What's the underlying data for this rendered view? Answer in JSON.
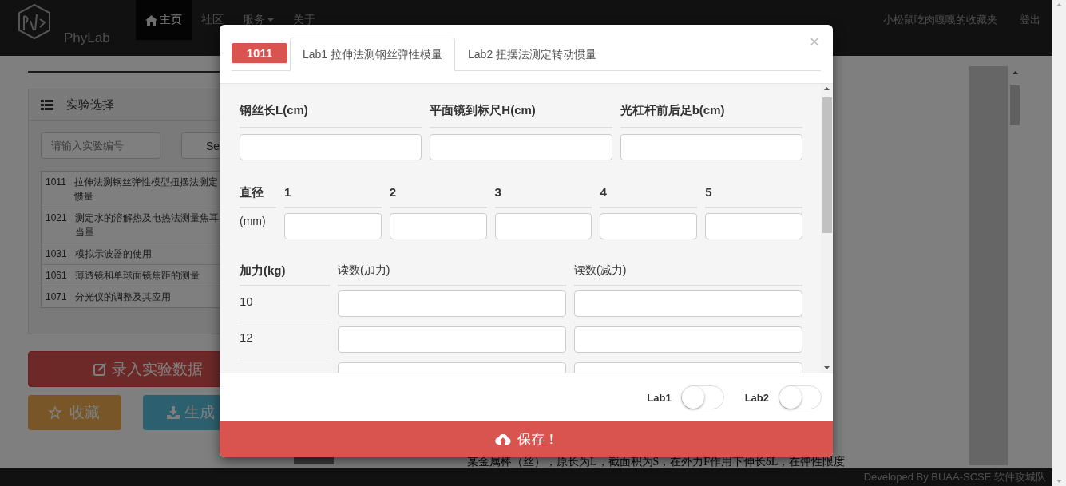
{
  "navbar": {
    "brand": "PhyLab",
    "items": [
      {
        "label": "主页",
        "selected": true
      },
      {
        "label": "社区",
        "selected": false
      },
      {
        "label": "服务",
        "selected": false,
        "dropdown": true
      },
      {
        "label": "关于",
        "selected": false
      }
    ],
    "user": "小松鼠吃肉嘎嘎的收藏夹",
    "logout": "登出"
  },
  "sidebar": {
    "title": "实验选择",
    "search_placeholder": "请输入实验编号",
    "search_button": "Se",
    "experiments": [
      {
        "code": "1011",
        "name": "拉伸法测钢丝弹性模型扭摆法测定",
        "name_continued": "惯量"
      },
      {
        "code": "1021",
        "name": "测定水的溶解热及电热法测量焦耳",
        "name_continued": "当量"
      },
      {
        "code": "1031",
        "name": "模拟示波器的使用"
      },
      {
        "code": "1061",
        "name": "薄透镜和单球面镜焦距的测量"
      },
      {
        "code": "1071",
        "name": "分光仪的调整及其应用"
      }
    ],
    "enter_button": "录入实验数据",
    "favorite_button": "收藏",
    "report_button": "生成"
  },
  "document_text": "某金属棒（丝），原长为L，截面积为S，在外力F作用下伸长δL，在弹性限度",
  "modal": {
    "badge": "1011",
    "tabs": [
      {
        "label": "Lab1 拉伸法测钢丝弹性模量",
        "selected": true
      },
      {
        "label": "Lab2 扭摆法测定转动惯量",
        "selected": false
      }
    ],
    "close": "×",
    "length_fields": [
      "钢丝长L(cm)",
      "平面镜到标尺H(cm)",
      "光杠杆前后足b(cm)"
    ],
    "diameter": {
      "label": "直径",
      "unit": "(mm)",
      "columns": [
        "1",
        "2",
        "3",
        "4",
        "5"
      ]
    },
    "force_table": {
      "columns": [
        "加力(kg)",
        "读数(加力)",
        "读数(减力)"
      ],
      "rows": [
        "10",
        "12"
      ]
    },
    "toggles": [
      {
        "label": "Lab1",
        "on": false
      },
      {
        "label": "Lab2",
        "on": false
      }
    ],
    "save_button": "保存！"
  },
  "footer": "Developed By BUAA-SCSE 软件攻城队"
}
